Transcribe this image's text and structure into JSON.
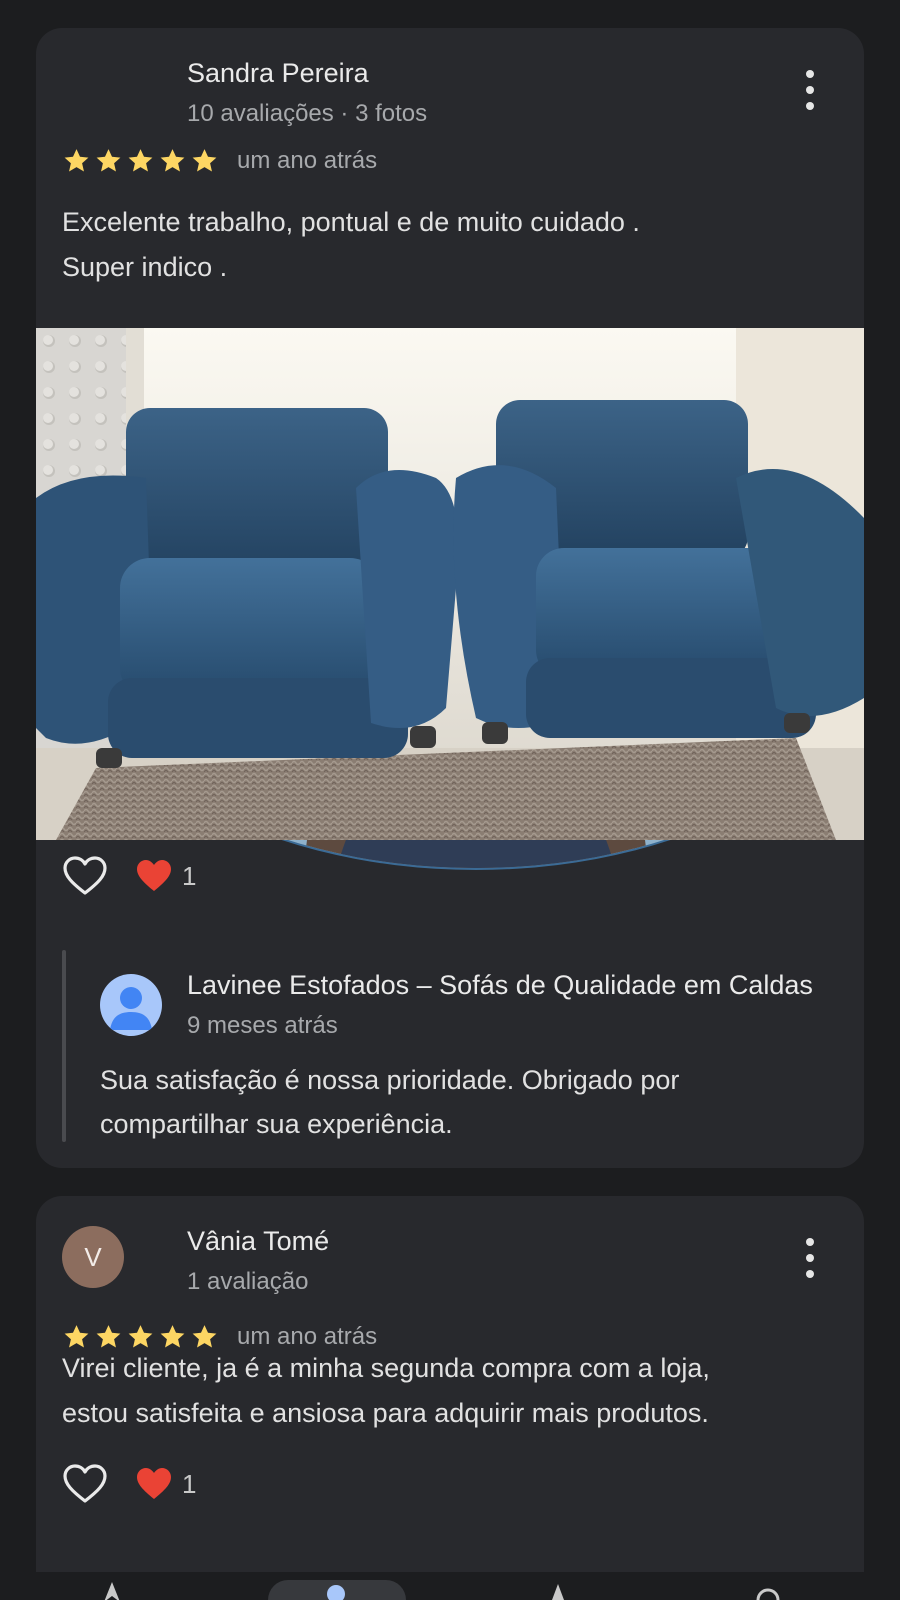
{
  "reviews": [
    {
      "author": "Sandra Pereira",
      "meta": "10 avaliações · 3 fotos",
      "rating": 5,
      "time": "um ano atrás",
      "text_lines": [
        "Excelente trabalho, pontual e de muito cuidado .",
        "Super indico ."
      ],
      "like_count": "1",
      "reply": {
        "name": "Lavinee Estofados – Sofás de Qualidade em Caldas",
        "time": "9 meses atrás",
        "text_lines": [
          "Sua satisfação é nossa prioridade. Obrigado por",
          "compartilhar sua experiência."
        ]
      }
    },
    {
      "author": "Vânia Tomé",
      "meta": "1 avaliação",
      "avatar_letter": "V",
      "rating": 5,
      "time": "um ano atrás",
      "text_lines": [
        "Virei cliente, ja é a minha segunda compra com a loja,",
        "estou satisfeita e ansiosa para adquirir mais produtos."
      ],
      "like_count": "1"
    }
  ],
  "colors": {
    "background": "#1c1d1f",
    "card": "#28292d",
    "star": "#fdd663",
    "heart": "#ea4335",
    "secondary_text": "#a7a9ac"
  },
  "icons": {
    "more": "more-vert-icon",
    "like": "heart-outline-icon",
    "reaction": "heart-filled-icon",
    "star": "star-icon"
  }
}
